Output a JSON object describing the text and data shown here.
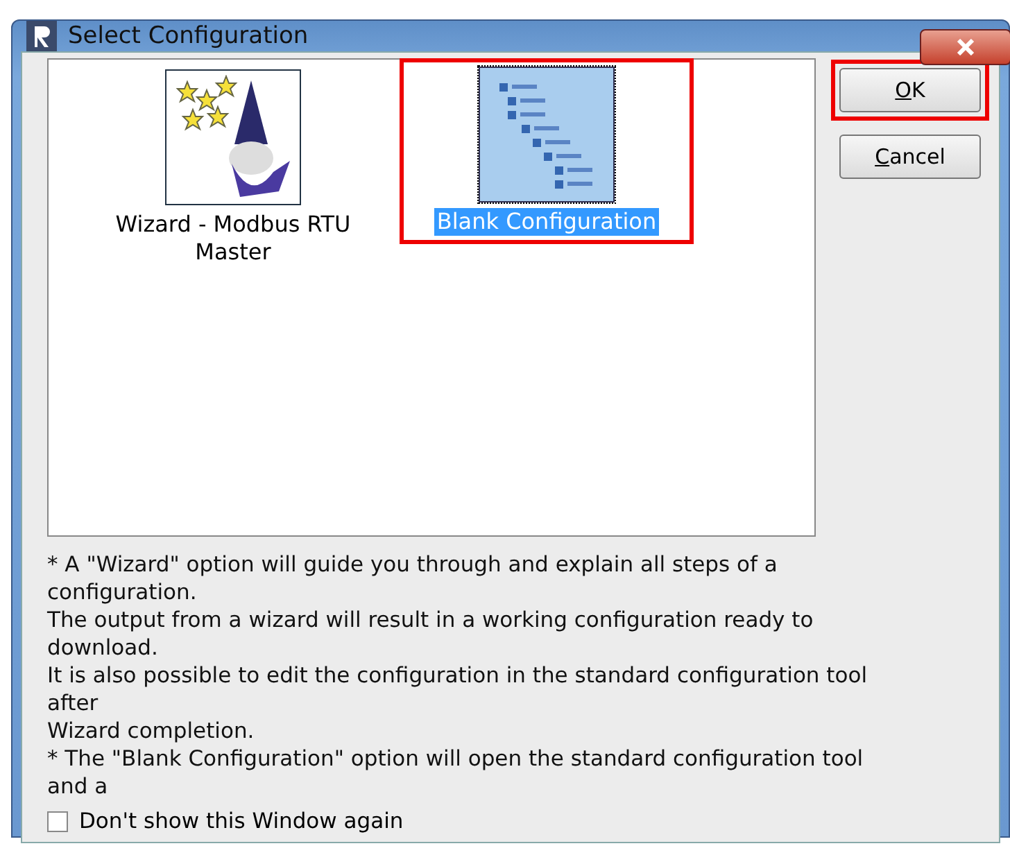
{
  "window": {
    "title": "Select Configuration"
  },
  "options": [
    {
      "kind": "wizard",
      "label": "Wizard - Modbus RTU Master",
      "selected": false,
      "highlighted": false
    },
    {
      "kind": "blank",
      "label": "Blank Configuration",
      "selected": true,
      "highlighted": true
    }
  ],
  "buttons": [
    {
      "label": "OK",
      "highlighted": true
    },
    {
      "label": "Cancel",
      "highlighted": false
    }
  ],
  "description": [
    "* A \"Wizard\" option will guide you through and explain all steps of a",
    "configuration.",
    "The output from a wizard will result in a working configuration ready to",
    "download.",
    "It is also possible to edit the configuration in the standard configuration tool",
    "after",
    "Wizard completion.",
    "* The \"Blank Configuration\" option will open the standard configuration tool",
    "and a"
  ],
  "dont_show_again": {
    "label": "Don't show this Window again",
    "checked": false
  }
}
